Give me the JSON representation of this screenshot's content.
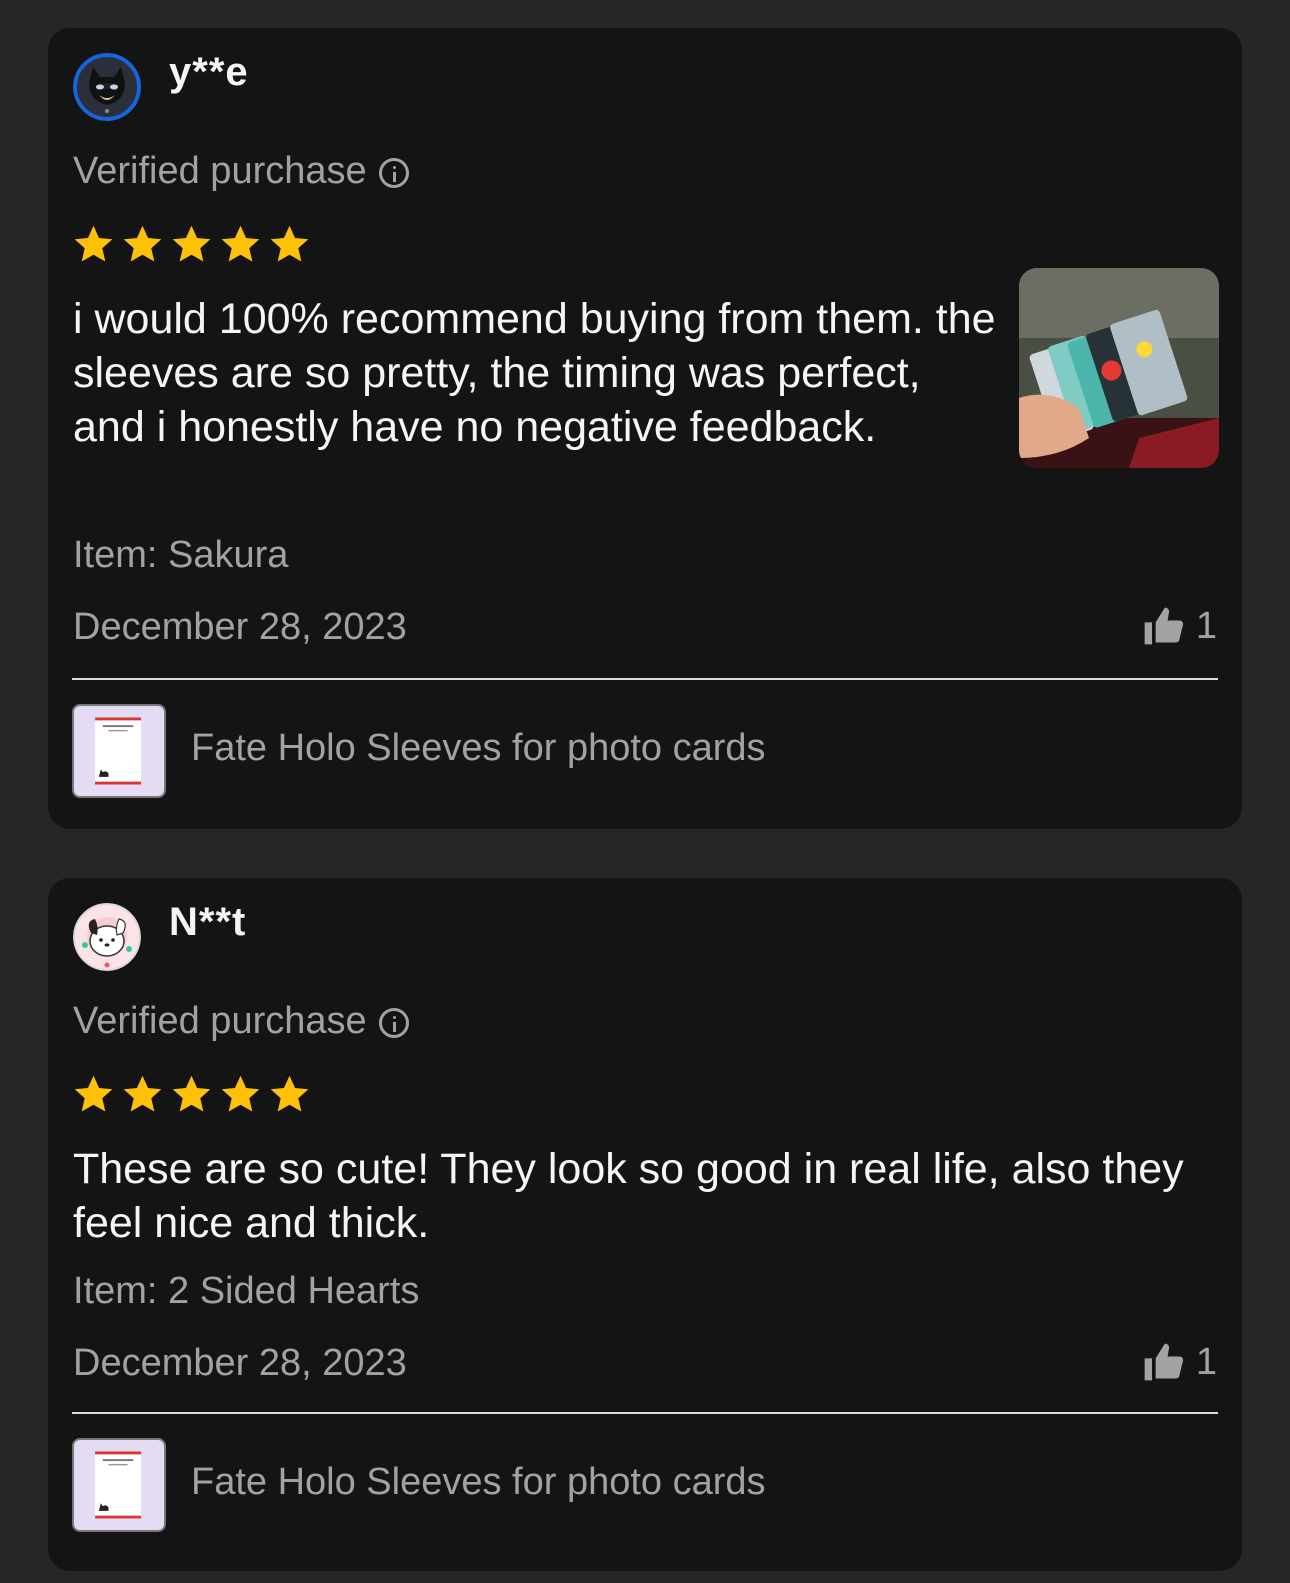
{
  "reviews": [
    {
      "username": "y**e",
      "avatar_icon": "catwoman-avatar",
      "verified_label": "Verified purchase",
      "rating": 5,
      "rating_max": 5,
      "text": "i would 100% recommend buying from them. the sleeves are so pretty, the timing was perfect, and i honestly have no negative feedback.",
      "has_photo": true,
      "item_label": "Item: Sakura",
      "date": "December 28, 2023",
      "likes": "1",
      "product_name": "Fate Holo Sleeves for photo cards"
    },
    {
      "username": "N**t",
      "avatar_icon": "pochacco-avatar",
      "verified_label": "Verified purchase",
      "rating": 5,
      "rating_max": 5,
      "text": "These are so cute! They look so good in real life, also they feel nice and thick.",
      "has_photo": false,
      "item_label": "Item: 2 Sided Hearts",
      "date": "December 28, 2023",
      "likes": "1",
      "product_name": "Fate Holo Sleeves for photo cards"
    }
  ],
  "colors": {
    "background": "#262626",
    "card": "#141414",
    "star": "#ffc107",
    "muted_text": "#a2a2a2"
  }
}
